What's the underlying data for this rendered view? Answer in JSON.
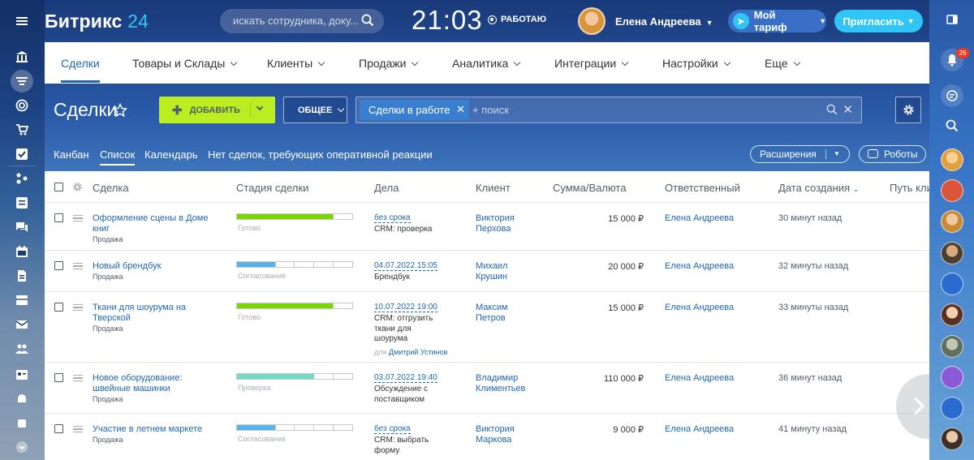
{
  "header": {
    "logo_text": "Битрикс",
    "logo_num": "24",
    "search_placeholder": "искать сотрудника, доку...",
    "clock": "21:03",
    "work_status": "РАБОТАЮ",
    "user_name": "Елена Андреева",
    "tariff_label": "Мой тариф",
    "invite_label": "Пригласить"
  },
  "topmenu": [
    {
      "label": "Сделки",
      "active": true,
      "has_caret": false
    },
    {
      "label": "Товары и Склады",
      "has_caret": true
    },
    {
      "label": "Клиенты",
      "has_caret": true
    },
    {
      "label": "Продажи",
      "has_caret": true
    },
    {
      "label": "Аналитика",
      "has_caret": true
    },
    {
      "label": "Интеграции",
      "has_caret": true
    },
    {
      "label": "Настройки",
      "has_caret": true
    },
    {
      "label": "Еще",
      "has_caret": true
    }
  ],
  "toolbar": {
    "page_title": "Сделки",
    "add_label": "ДОБАВИТЬ",
    "category_label": "ОБЩЕЕ",
    "filter_tag": "Сделки в работе",
    "filter_placeholder": "+ поиск"
  },
  "views": {
    "kanban": "Канбан",
    "list": "Список",
    "calendar": "Календарь",
    "no_reaction": "Нет сделок, требующих оперативной реакции",
    "extensions": "Расширения",
    "robots": "Роботы"
  },
  "table": {
    "columns": {
      "deal": "Сделка",
      "stage": "Стадия сделки",
      "activities": "Дела",
      "client": "Клиент",
      "sum": "Сумма/Валюта",
      "responsible": "Ответственный",
      "created": "Дата создания",
      "route": "Путь кли"
    },
    "rows": [
      {
        "title": "Оформление сцены в Доме книг",
        "subtitle": "Продажа",
        "stage": "Готово",
        "stage_fill": 0.83,
        "stage_color": "#7bd500",
        "act_date": "без срока",
        "act_text": "CRM: проверка",
        "act_for_prefix": "",
        "act_for_name": "",
        "client": "Виктория Перхова",
        "sum": "15 000 ₽",
        "responsible": "Елена Андреева",
        "created": "30 минут назад"
      },
      {
        "title": "Новый брендбук",
        "subtitle": "Продажа",
        "stage": "Согласование",
        "stage_fill": 0.33,
        "stage_color": "#56b4e9",
        "act_date": "04.07.2022 15:05",
        "act_text": "Брендбук",
        "act_for_prefix": "",
        "act_for_name": "",
        "client": "Михаил Крушин",
        "sum": "20 000 ₽",
        "responsible": "Елена Андреева",
        "created": "32 минуты назад"
      },
      {
        "title": "Ткани для шоурума на Тверской",
        "subtitle": "Продажа",
        "stage": "Готово",
        "stage_fill": 0.83,
        "stage_color": "#7bd500",
        "act_date": "10.07.2022 19:00",
        "act_text": "CRM: отгрузить ткани для шоурума",
        "act_for_prefix": "для",
        "act_for_name": "Дмитрий Устинов",
        "client": "Максим Петров",
        "sum": "15 000 ₽",
        "responsible": "Елена Андреева",
        "created": "33 минуты назад"
      },
      {
        "title": "Новое оборудование: швейные машинки",
        "subtitle": "Продажа",
        "stage": "Проверка",
        "stage_fill": 0.67,
        "stage_color": "#6fdbc0",
        "act_date": "03.07.2022 19:40",
        "act_text": "Обсуждение с поставщиком",
        "act_for_prefix": "",
        "act_for_name": "",
        "client": "Владимир Климентьев",
        "sum": "110 000 ₽",
        "responsible": "Елена Андреева",
        "created": "36 минут назад"
      },
      {
        "title": "Участие в летнем маркете",
        "subtitle": "Продажа",
        "stage": "Согласование",
        "stage_fill": 0.33,
        "stage_color": "#56b4e9",
        "act_date": "без срока",
        "act_text": "CRM: выбрать форму",
        "act_for_prefix": "",
        "act_for_name": "",
        "client": "Виктория Маркова",
        "sum": "9 000 ₽",
        "responsible": "Елена Андреева",
        "created": "41 минуту назад"
      }
    ]
  },
  "right_rail": {
    "notifications_badge": "26"
  },
  "colors": {
    "accent": "#2fc6f6",
    "add_button": "#bbed21",
    "link": "#2067b0"
  }
}
